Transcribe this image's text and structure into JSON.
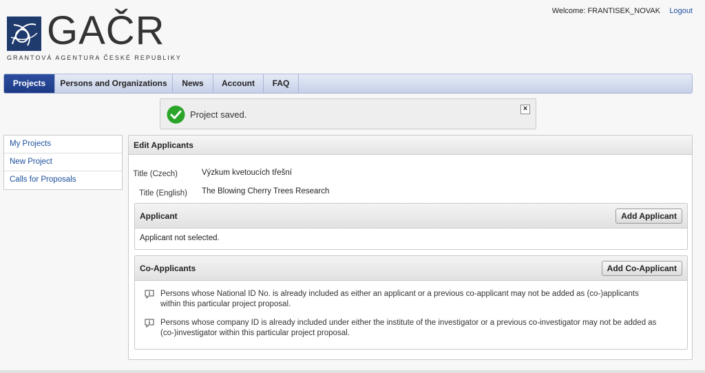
{
  "header": {
    "logo_text": "GAČR",
    "logo_subtitle": "GRANTOVÁ AGENTURA ČESKÉ REPUBLIKY",
    "welcome": "Welcome: FRANTISEK_NOVAK",
    "logout": "Logout"
  },
  "nav": {
    "items": [
      {
        "label": "Projects",
        "active": true
      },
      {
        "label": "Persons and Organizations"
      },
      {
        "label": "News"
      },
      {
        "label": "Account"
      },
      {
        "label": "FAQ"
      }
    ]
  },
  "notice": {
    "text": "Project saved.",
    "close": "×",
    "icon": "check-circle-icon"
  },
  "sidebar": {
    "items": [
      {
        "label": "My Projects"
      },
      {
        "label": "New Project"
      },
      {
        "label": "Calls for Proposals"
      }
    ]
  },
  "main": {
    "title": "Edit Applicants",
    "fields": {
      "title_cz_label": "Title (Czech)",
      "title_cz_value": "Výzkum kvetoucích třešní",
      "title_en_label": "Title (English)",
      "title_en_value": "The Blowing Cherry Trees Research"
    },
    "applicant": {
      "title": "Applicant",
      "button": "Add Applicant",
      "empty_text": "Applicant not selected."
    },
    "co_applicants": {
      "title": "Co-Applicants",
      "button": "Add Co-Applicant",
      "notes": [
        "Persons whose National ID No. is already included as either an applicant or a previous co-applicant may not be added as (co-)applicants within this particular project proposal.",
        "Persons whose company ID is already included under either the institute of the investigator or a previous co-investigator may not be added as (co-)investigator within this particular project proposal."
      ]
    }
  },
  "colors": {
    "brand": "#1f3a6d",
    "nav_active": "#2c4ea0",
    "link": "#1b4f9c",
    "success": "#2aa52a"
  }
}
